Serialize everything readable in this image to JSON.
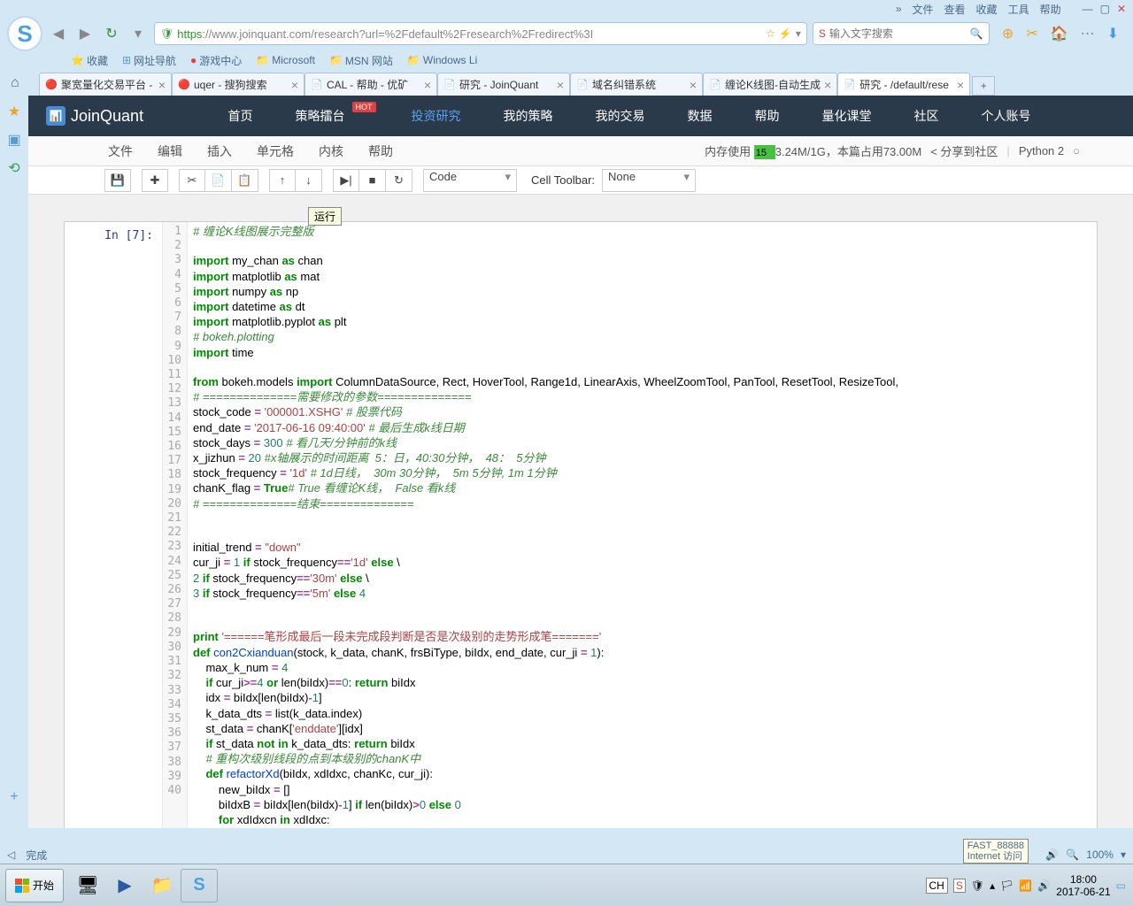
{
  "browser_menu": [
    "文件",
    "查看",
    "收藏",
    "工具",
    "帮助"
  ],
  "url": {
    "prefix": "https",
    "rest": "://www.joinquant.com/research?url=%2Fdefault%2Fresearch%2Fredirect%3I"
  },
  "search_placeholder": "输入文字搜索",
  "bookmarks": [
    {
      "icon": "⭐",
      "label": "收藏",
      "color": "#f0a030"
    },
    {
      "icon": "⊞",
      "label": "网址导航",
      "color": "#5a9ad0"
    },
    {
      "icon": "🔴",
      "label": "游戏中心",
      "color": "#e04040"
    },
    {
      "icon": "📁",
      "label": "Microsoft",
      "color": "#e0b060"
    },
    {
      "icon": "📁",
      "label": "MSN 网站",
      "color": "#e0b060"
    },
    {
      "icon": "📁",
      "label": "Windows Li",
      "color": "#e0b060"
    }
  ],
  "tabs": [
    {
      "fav": "🔴",
      "title": "聚宽量化交易平台 - ",
      "active": false
    },
    {
      "fav": "🔴",
      "title": "uqer - 搜狗搜索",
      "active": false
    },
    {
      "fav": "📄",
      "title": "CAL - 帮助 - 优矿",
      "active": false
    },
    {
      "fav": "📄",
      "title": "研究 - JoinQuant",
      "active": false
    },
    {
      "fav": "📄",
      "title": "域名纠错系统",
      "active": false
    },
    {
      "fav": "📄",
      "title": "缠论K线图-自动生成",
      "active": false
    },
    {
      "fav": "📄",
      "title": "研究 - /default/rese",
      "active": true
    }
  ],
  "jq_nav": [
    "首页",
    "策略擂台",
    "投资研究",
    "我的策略",
    "我的交易",
    "数据",
    "帮助",
    "量化课堂",
    "社区",
    "个人账号"
  ],
  "jq_nav_active": 2,
  "jq_nav_hot_idx": 1,
  "jq_hot_label": "HOT",
  "jup_menu": [
    "文件",
    "编辑",
    "插入",
    "单元格",
    "内核",
    "帮助"
  ],
  "mem_label_prefix": "内存使用",
  "mem_pct": "15",
  "mem_text": "3.24M/1G，本篇占用73.00M",
  "share_label": "分享到社区",
  "kernel_label": "Python 2",
  "celltype": "Code",
  "cell_toolbar_label": "Cell Toolbar:",
  "cell_toolbar_value": "None",
  "tooltip": "运行",
  "prompt": "In [7]:",
  "code_lines": [
    [
      [
        "cm",
        "# 缠论K线图展示完整版"
      ]
    ],
    [],
    [
      [
        "kw",
        "import"
      ],
      [
        "nm",
        " my_chan "
      ],
      [
        "kw",
        "as"
      ],
      [
        "nm",
        " chan"
      ]
    ],
    [
      [
        "kw",
        "import"
      ],
      [
        "nm",
        " matplotlib "
      ],
      [
        "kw",
        "as"
      ],
      [
        "nm",
        " mat"
      ]
    ],
    [
      [
        "kw",
        "import"
      ],
      [
        "nm",
        " numpy "
      ],
      [
        "kw",
        "as"
      ],
      [
        "nm",
        " np"
      ]
    ],
    [
      [
        "kw",
        "import"
      ],
      [
        "nm",
        " datetime "
      ],
      [
        "kw",
        "as"
      ],
      [
        "nm",
        " dt"
      ]
    ],
    [
      [
        "kw",
        "import"
      ],
      [
        "nm",
        " matplotlib.pyplot "
      ],
      [
        "kw",
        "as"
      ],
      [
        "nm",
        " plt"
      ]
    ],
    [
      [
        "cm",
        "# bokeh.plotting"
      ]
    ],
    [
      [
        "kw",
        "import"
      ],
      [
        "nm",
        " time"
      ]
    ],
    [],
    [
      [
        "kw",
        "from"
      ],
      [
        "nm",
        " bokeh.models "
      ],
      [
        "kw",
        "import"
      ],
      [
        "nm",
        " ColumnDataSource, Rect, HoverTool, Range1d, LinearAxis, WheelZoomTool, PanTool, ResetTool, ResizeTool, "
      ]
    ],
    [
      [
        "cm",
        "# ==============需要修改的参数=============="
      ]
    ],
    [
      [
        "nm",
        "stock_code "
      ],
      [
        "op",
        "="
      ],
      [
        "nm",
        " "
      ],
      [
        "str",
        "'000001.XSHG'"
      ],
      [
        "nm",
        " "
      ],
      [
        "cm",
        "# 股票代码"
      ]
    ],
    [
      [
        "nm",
        "end_date "
      ],
      [
        "op",
        "="
      ],
      [
        "nm",
        " "
      ],
      [
        "str",
        "'2017-06-16 09:40:00'"
      ],
      [
        "nm",
        " "
      ],
      [
        "cm",
        "# 最后生成k线日期"
      ]
    ],
    [
      [
        "nm",
        "stock_days "
      ],
      [
        "op",
        "="
      ],
      [
        "nm",
        " "
      ],
      [
        "num",
        "300"
      ],
      [
        "nm",
        " "
      ],
      [
        "cm",
        "# 看几天/分钟前的k线"
      ]
    ],
    [
      [
        "nm",
        "x_jizhun "
      ],
      [
        "op",
        "="
      ],
      [
        "nm",
        " "
      ],
      [
        "num",
        "20"
      ],
      [
        "nm",
        " "
      ],
      [
        "cm",
        "#x轴展示的时间距离  5：日，40:30分钟，  48：  5分钟"
      ]
    ],
    [
      [
        "nm",
        "stock_frequency "
      ],
      [
        "op",
        "="
      ],
      [
        "nm",
        " "
      ],
      [
        "str",
        "'1d'"
      ],
      [
        "nm",
        " "
      ],
      [
        "cm",
        "# 1d日线，  30m 30分钟，  5m 5分钟, 1m 1分钟"
      ]
    ],
    [
      [
        "nm",
        "chanK_flag "
      ],
      [
        "op",
        "="
      ],
      [
        "nm",
        " "
      ],
      [
        "kw",
        "True"
      ],
      [
        "cm",
        "# True 看缠论K线，  False 看k线"
      ]
    ],
    [
      [
        "cm",
        "# ==============结束=============="
      ]
    ],
    [],
    [],
    [
      [
        "nm",
        "initial_trend "
      ],
      [
        "op",
        "="
      ],
      [
        "nm",
        " "
      ],
      [
        "str",
        "\"down\""
      ]
    ],
    [
      [
        "nm",
        "cur_ji "
      ],
      [
        "op",
        "="
      ],
      [
        "nm",
        " "
      ],
      [
        "num",
        "1"
      ],
      [
        "nm",
        " "
      ],
      [
        "kw",
        "if"
      ],
      [
        "nm",
        " stock_frequency"
      ],
      [
        "op",
        "=="
      ],
      [
        "str",
        "'1d'"
      ],
      [
        "nm",
        " "
      ],
      [
        "kw",
        "else"
      ],
      [
        "nm",
        " \\"
      ]
    ],
    [
      [
        "num",
        "2"
      ],
      [
        "nm",
        " "
      ],
      [
        "kw",
        "if"
      ],
      [
        "nm",
        " stock_frequency"
      ],
      [
        "op",
        "=="
      ],
      [
        "str",
        "'30m'"
      ],
      [
        "nm",
        " "
      ],
      [
        "kw",
        "else"
      ],
      [
        "nm",
        " \\"
      ]
    ],
    [
      [
        "num",
        "3"
      ],
      [
        "nm",
        " "
      ],
      [
        "kw",
        "if"
      ],
      [
        "nm",
        " stock_frequency"
      ],
      [
        "op",
        "=="
      ],
      [
        "str",
        "'5m'"
      ],
      [
        "nm",
        " "
      ],
      [
        "kw",
        "else"
      ],
      [
        "nm",
        " "
      ],
      [
        "num",
        "4"
      ]
    ],
    [],
    [],
    [
      [
        "kw",
        "print"
      ],
      [
        "nm",
        " "
      ],
      [
        "str",
        "'======笔形成最后一段未完成段判断是否是次级别的走势形成笔======='"
      ]
    ],
    [
      [
        "kw",
        "def"
      ],
      [
        "nm",
        " "
      ],
      [
        "def",
        "con2Cxianduan"
      ],
      [
        "nm",
        "(stock, k_data, chanK, frsBiType, biIdx, end_date, cur_ji "
      ],
      [
        "op",
        "="
      ],
      [
        "nm",
        " "
      ],
      [
        "num",
        "1"
      ],
      [
        "nm",
        "):"
      ]
    ],
    [
      [
        "nm",
        "    max_k_num "
      ],
      [
        "op",
        "="
      ],
      [
        "nm",
        " "
      ],
      [
        "num",
        "4"
      ]
    ],
    [
      [
        "nm",
        "    "
      ],
      [
        "kw",
        "if"
      ],
      [
        "nm",
        " cur_ji"
      ],
      [
        "op",
        ">="
      ],
      [
        "num",
        "4"
      ],
      [
        "nm",
        " "
      ],
      [
        "kw",
        "or"
      ],
      [
        "nm",
        " len(biIdx)"
      ],
      [
        "op",
        "=="
      ],
      [
        "num",
        "0"
      ],
      [
        "nm",
        ": "
      ],
      [
        "kw",
        "return"
      ],
      [
        "nm",
        " biIdx"
      ]
    ],
    [
      [
        "nm",
        "    idx "
      ],
      [
        "op",
        "="
      ],
      [
        "nm",
        " biIdx[len(biIdx)"
      ],
      [
        "op",
        "-"
      ],
      [
        "num",
        "1"
      ],
      [
        "nm",
        "]"
      ]
    ],
    [
      [
        "nm",
        "    k_data_dts "
      ],
      [
        "op",
        "="
      ],
      [
        "nm",
        " list(k_data.index)"
      ]
    ],
    [
      [
        "nm",
        "    st_data "
      ],
      [
        "op",
        "="
      ],
      [
        "nm",
        " chanK["
      ],
      [
        "str",
        "'enddate'"
      ],
      [
        "nm",
        "][idx]"
      ]
    ],
    [
      [
        "nm",
        "    "
      ],
      [
        "kw",
        "if"
      ],
      [
        "nm",
        " st_data "
      ],
      [
        "kw",
        "not"
      ],
      [
        "nm",
        " "
      ],
      [
        "kw",
        "in"
      ],
      [
        "nm",
        " k_data_dts: "
      ],
      [
        "kw",
        "return"
      ],
      [
        "nm",
        " biIdx"
      ]
    ],
    [
      [
        "nm",
        "    "
      ],
      [
        "cm",
        "# 重构次级别线段的点到本级别的chanK中"
      ]
    ],
    [
      [
        "nm",
        "    "
      ],
      [
        "kw",
        "def"
      ],
      [
        "nm",
        " "
      ],
      [
        "def",
        "refactorXd"
      ],
      [
        "nm",
        "(biIdx, xdIdxc, chanKc, cur_ji):"
      ]
    ],
    [
      [
        "nm",
        "        new_biIdx "
      ],
      [
        "op",
        "="
      ],
      [
        "nm",
        " []"
      ]
    ],
    [
      [
        "nm",
        "        biIdxB "
      ],
      [
        "op",
        "="
      ],
      [
        "nm",
        " biIdx[len(biIdx)"
      ],
      [
        "op",
        "-"
      ],
      [
        "num",
        "1"
      ],
      [
        "nm",
        "] "
      ],
      [
        "kw",
        "if"
      ],
      [
        "nm",
        " len(biIdx)"
      ],
      [
        "op",
        ">"
      ],
      [
        "num",
        "0"
      ],
      [
        "nm",
        " "
      ],
      [
        "kw",
        "else"
      ],
      [
        "nm",
        " "
      ],
      [
        "num",
        "0"
      ]
    ],
    [
      [
        "nm",
        "        "
      ],
      [
        "kw",
        "for"
      ],
      [
        "nm",
        " xdIdxcn "
      ],
      [
        "kw",
        "in"
      ],
      [
        "nm",
        " xdIdxc:"
      ]
    ]
  ],
  "status_done": "完成",
  "status_zoom": "100%",
  "net_tip_l1": "FAST_88888",
  "net_tip_l2": "Internet 访问",
  "start_label": "开始",
  "ime": "CH",
  "clock_time": "18:00",
  "clock_date": "2017-06-21"
}
